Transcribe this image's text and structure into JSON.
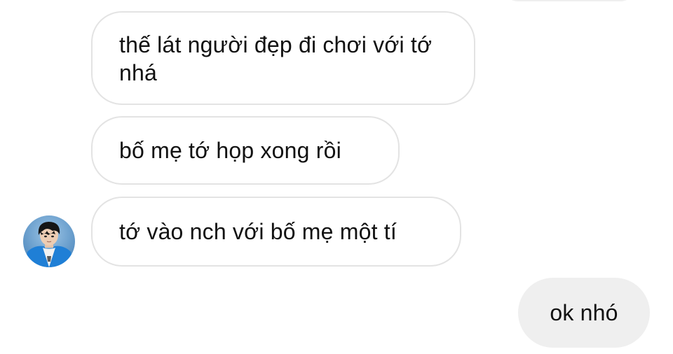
{
  "conversation": {
    "messages": [
      {
        "sender": "contact",
        "text": "thế lát người đẹp đi chơi với tớ nhá"
      },
      {
        "sender": "contact",
        "text": "bố mẹ tớ họp xong rồi"
      },
      {
        "sender": "contact",
        "text": "tớ vào nch với bố mẹ một tí"
      },
      {
        "sender": "me",
        "text": "ok nhó"
      }
    ],
    "avatar_icon": "contact-avatar-photo"
  },
  "colors": {
    "background": "#ffffff",
    "incoming_bubble_border": "#e3e3e3",
    "outgoing_bubble_fill": "#efefef",
    "text": "#111111",
    "avatar_blue": "#1f7fd6"
  }
}
